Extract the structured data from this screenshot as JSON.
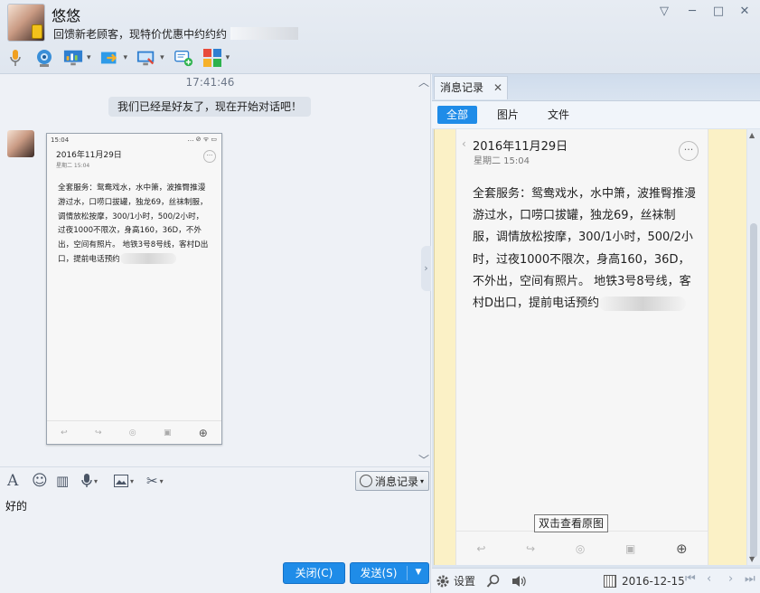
{
  "contact": {
    "name": "悠悠",
    "signature": "回馈新老顾客，现特价优惠中约约约"
  },
  "window": {
    "menu_icon": "▽",
    "minimize_icon": "─",
    "maximize_icon": "□",
    "close_icon": "✕"
  },
  "toolbar": {
    "caret": "▾",
    "icons": [
      "microphone-icon",
      "video-call-icon",
      "screen-share-icon",
      "file-transfer-icon",
      "remote-desktop-icon",
      "add-chat-icon",
      "apps-icon"
    ]
  },
  "chat": {
    "timestamp": "17:41:46",
    "system_message": "我们已经是好友了，现在开始对话吧！",
    "collapse_up": "︿",
    "collapse_down": "﹀",
    "splitter": "›"
  },
  "phone_image": {
    "status_time": "15:04",
    "status_icons": "… ⊘ ᯤ ▭",
    "back": "‹",
    "date": "2016年11月29日",
    "weekday_time": "星期二 15:04",
    "more": "···",
    "body_text": "全套服务：鸳鸯戏水，水中箫，波推臀推漫游过水，口唠口拔罐，独龙69，丝袜制服，调情放松按摩，300/1小时，500/2小时，过夜1000不限次，身高160，36D，不外出，空间有照片。 地铁3号8号线，客村D出口，提前电话预约",
    "footer_icons": [
      "↩",
      "↪",
      "◎",
      "▣",
      "⊕"
    ]
  },
  "input_toolbar": {
    "font": "A",
    "emoji": "☺",
    "gif": "▥",
    "voice": "🎙",
    "image": "▨",
    "screenshot": "✂",
    "caret": "▾",
    "history_label": "消息记录"
  },
  "input": {
    "text": "好的"
  },
  "buttons": {
    "close_label": "关闭(C)",
    "send_label": "发送(S)",
    "send_menu": "▼"
  },
  "history": {
    "tab_label": "消息记录",
    "tab_close": "✕",
    "filters": [
      "全部",
      "图片",
      "文件"
    ],
    "tooltip": "双击查看原图",
    "scroll_up": "▲",
    "scroll_down": "▼",
    "settings_label": "设置",
    "date": "2016-12-15",
    "nav": [
      "⏮",
      "‹",
      "›",
      "⏭"
    ]
  },
  "colors": {
    "accent": "#1f8ce8",
    "history_bg": "#fbf1c6"
  }
}
